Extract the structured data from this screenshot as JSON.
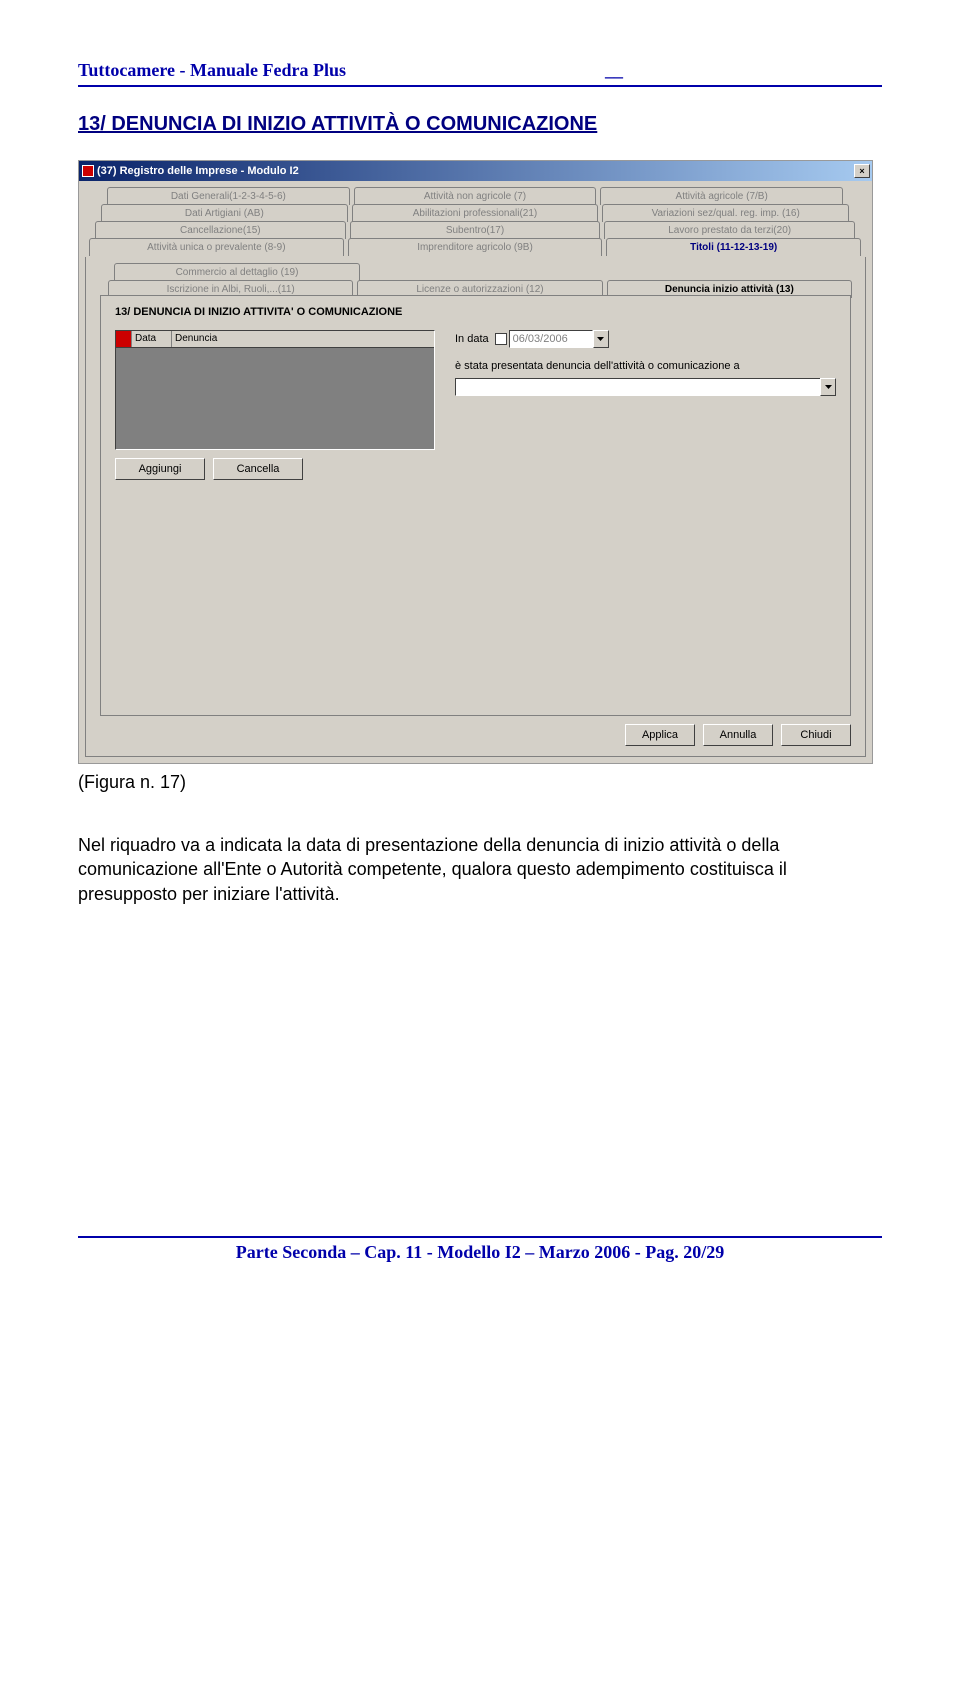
{
  "doc": {
    "header_left": "Tuttocamere - Manuale Fedra Plus",
    "header_mid": "__"
  },
  "section": {
    "title": "13/ DENUNCIA DI INIZIO ATTIVITÀ O COMUNICAZIONE"
  },
  "figure_caption": "(Figura n. 17)",
  "paragraph": "Nel riquadro va a indicata la data di presentazione della denuncia di inizio attività o della comunicazione all'Ente o Autorità competente, qualora questo adempimento costituisca il presupposto per iniziare l'attività.",
  "footer": "Parte Seconda – Cap. 11 - Modello I2 – Marzo 2006 - Pag. 20/29",
  "win": {
    "title": "(37) Registro delle Imprese - Modulo I2",
    "tabs_row1": [
      "Dati Generali(1-2-3-4-5-6)",
      "Attività non agricole (7)",
      "Attività agricole (7/B)"
    ],
    "tabs_row2": [
      "Dati Artigiani (AB)",
      "Abilitazioni professionali(21)",
      "Variazioni sez/qual. reg. imp. (16)"
    ],
    "tabs_row3": [
      "Cancellazione(15)",
      "Subentro(17)",
      "Lavoro prestato da terzi(20)"
    ],
    "tabs_row4": [
      "Attività unica o prevalente (8-9)",
      "Imprenditore agricolo (9B)",
      "Titoli (11-12-13-19)"
    ],
    "subtabs_row1": [
      "Commercio al dettaglio (19)"
    ],
    "subtabs_row2": [
      "Iscrizione in Albi, Ruoli,...(11)",
      "Licenze o autorizzazioni (12)",
      "Denuncia inizio attività (13)"
    ],
    "panel_title": "13/ DENUNCIA DI INIZIO ATTIVITA' O COMUNICAZIONE",
    "list_header": {
      "col1": "Data",
      "col2": "Denuncia"
    },
    "buttons": {
      "add": "Aggiungi",
      "del": "Cancella"
    },
    "right": {
      "in_data_label": "In data",
      "date_value": "06/03/2006",
      "desc": "è stata presentata denuncia dell'attività o comunicazione a"
    },
    "bottom": {
      "apply": "Applica",
      "cancel": "Annulla",
      "close": "Chiudi"
    }
  }
}
